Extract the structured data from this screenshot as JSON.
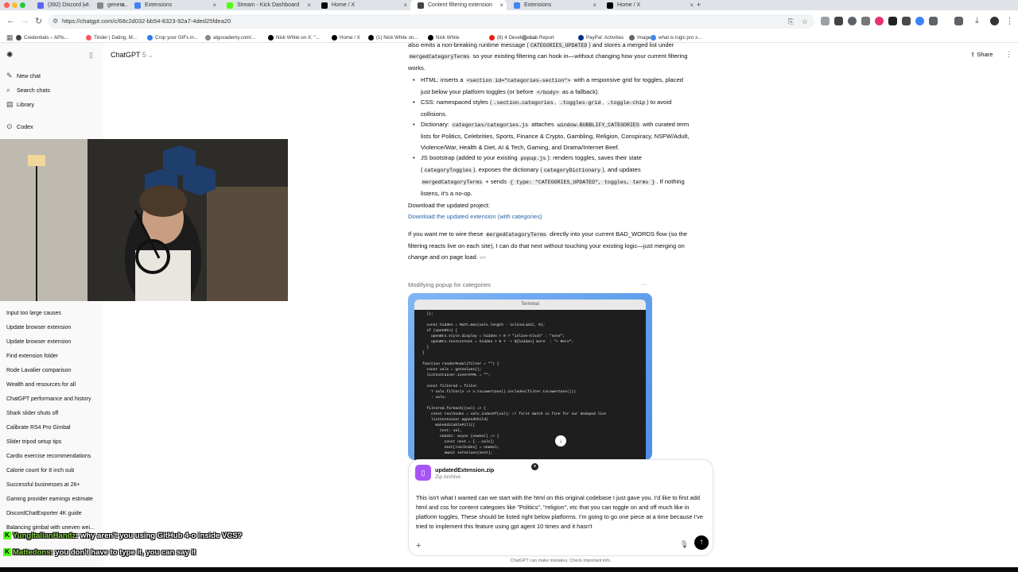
{
  "browser": {
    "tabs": [
      {
        "label": "(392) Discord | #...",
        "color": "#5865f2"
      },
      {
        "label": "genera...",
        "color": "#888888"
      },
      {
        "label": "Extensions",
        "color": "#4285f4"
      },
      {
        "label": "Home / X",
        "color": "#000000"
      },
      {
        "label": "Stream - Kick Dashboard",
        "color": "#53fc18"
      },
      {
        "label": "Home / X",
        "color": "#000000"
      },
      {
        "label": "Content filtering extension",
        "color": "#444444"
      },
      {
        "label": "Extensions",
        "color": "#4285f4"
      },
      {
        "label": "Home / X",
        "color": "#000000"
      }
    ],
    "new_tab": "+",
    "url": "https://chatgpt.com/c/68c2d032-bb54-8323-92a7-4ded25fdea20",
    "bookmarks": [
      "Credentials – APIs...",
      "Tinder | Dating, M...",
      "Crop your GIFs in...",
      "algocademy.com/...",
      "Nick White on X: \"...",
      "Home / X",
      "(1) Nick White on...",
      "Nick White",
      "(8) 4 Developers...",
      "Lab Report",
      "PayPal: Activities",
      "Image",
      "what is logic pro x..."
    ]
  },
  "sidebar": {
    "top": [
      {
        "label": "New chat",
        "icon": "edit-icon"
      },
      {
        "label": "Search chats",
        "icon": "search-icon"
      },
      {
        "label": "Library",
        "icon": "library-icon"
      },
      {
        "label": "Codex",
        "icon": "codex-icon"
      }
    ],
    "history": [
      "Input too large causes",
      "Update browser extension",
      "Update browser extension",
      "Find extension folder",
      "Rode Lavalier comparison",
      "Wealth and resources for all",
      "ChatGPT performance and history",
      "Shark slider shuts off",
      "Calibrate RS4 Pro Gimbal",
      "Slider tripod setup tips",
      "Cardio exercise recommendations",
      "Calorie count for 8 inch sub",
      "Successful businesses at 28+",
      "Gaming provider earnings estimate",
      "DiscordChatExporter 4K guide",
      "Balancing gimbal with uneven wei..."
    ]
  },
  "header": {
    "title": "ChatGPT",
    "version": "5",
    "share": "Share"
  },
  "message": {
    "intro_a": "also emits a non-breaking runtime message (",
    "intro_code": "CATEGORIES_UPDATED",
    "intro_b": ") and stores a merged list under",
    "intro_code2": "mergedCategoryTerms",
    "intro_c": "so your existing filtering can hook in—without changing how your current filtering",
    "intro_d": "works.",
    "b1_a": "HTML: inserts a",
    "b1_code": "<section id=\"categories-section\">",
    "b1_b": "with a responsive grid for toggles, placed",
    "b1_c": "just below your platform toggles (or before",
    "b1_code2": "</body>",
    "b1_d": "as a fallback).",
    "b2_a": "CSS: namespaced styles (",
    "b2_code1": ".section.categories",
    "b2_code2": ".toggles-grid",
    "b2_code3": ".toggle-chip",
    "b2_b": ") to avoid",
    "b2_c": "collisions.",
    "b3_a": "Dictionary:",
    "b3_code1": "categories/categories.js",
    "b3_b": "attaches",
    "b3_code2": "window.BUBBLIFY_CATEGORIES",
    "b3_c": "with curated term",
    "b3_d": "lists for Politics, Celebrities, Sports, Finance & Crypto, Gambling, Religion, Conspiracy, NSFW/Adult,",
    "b3_e": "Violence/War, Health & Diet, AI & Tech, Gaming, and Drama/Internet Beef.",
    "b4_a": "JS bootstrap (added to your existing",
    "b4_code1": "popup.js",
    "b4_b": "): renders toggles, saves their state",
    "b4_code2": "categoryToggles",
    "b4_c": "), exposes the dictionary (",
    "b4_code3": "categoryDictionary",
    "b4_d": "), and updates",
    "b4_code4": "mergedCategoryTerms",
    "b4_e": "+ sends",
    "b4_code5": "{ type: \"CATEGORIES_UPDATED\", toggles, terms }",
    "b4_f": ". If nothing",
    "b4_g": "listens, it's a no-op.",
    "download_label": "Download the updated project:",
    "download_link": "Download the updated extension (with categories)",
    "wire_a": "If you want me to wire these",
    "wire_code": "mergedCategoryTerms",
    "wire_b": "directly into your current BAD_WORDS flow (so the",
    "wire_c": "filtering reacts live on each site), I can do that next without touching your existing logic—just merging on",
    "wire_d": "change and on page load.",
    "wire_icon": "</>"
  },
  "card": {
    "title": "Modifying popup for categories",
    "menu": "···",
    "terminal_title": "Terminal",
    "code": "  });\n\n  const hidden = Math.max(vals.length - inlineLimit, 0);\n  if (openBtn) {\n    openBtn.style.display = hidden > 0 ? \"inline-block\" : \"none\";\n    openBtn.textContent = hidden > 0 ? `+ ${hidden} more` : \"+ More\";\n  }\n}\n\nfunction renderModal(filter = \"\") {\n  const vals = getValues();\n  listContainer.innerHTML = \"\";\n\n  const filtered = filter\n    ? vals.filter(v => v.toLowerCase().includes(filter.toLowerCase()))\n    : vals;\n\n  filtered.forEach((val) => {\n    const realIndex = vals.indexOf(val); // first match is fine for our deduped list\n    listContainer.appendChild(\n      makeEditablePill({\n        text: val,\n        onEdit: async (newVal) => {\n          const next = [...vals];\n          next[realIndex] = newVal;\n          await setValues(next);"
  },
  "composer": {
    "attachment_name": "updatedExtension.zip",
    "attachment_type": "Zip Archive",
    "text": "This isn't what I wanted can we start with the html on this original codebase I just gave you. I'd like to first add html and css for content categoies like \"Politics\", \"religion\", etc that you can toggle on and off much like in platform toggles. These should be listed right below platforms. I'm going to go one piece at a time because I've tried to implement this feature using gpt agent 10 times and it hasn't",
    "plus": "+",
    "send": "↑"
  },
  "disclaimer": "ChatGPT can make mistakes. Check important info.",
  "stream_chat": [
    {
      "user": "YungItalianHandz",
      "text": ": why aren't you using GitHub 4-o inside VCS?"
    },
    {
      "user": "Mattedons",
      "text": ": you don't have to type it, you can say it"
    }
  ],
  "icons": {
    "kick": "K"
  },
  "colors": {
    "link": "#2964aa",
    "send": "#000000",
    "kick": "#53fc18",
    "zip": "#a855f7"
  }
}
